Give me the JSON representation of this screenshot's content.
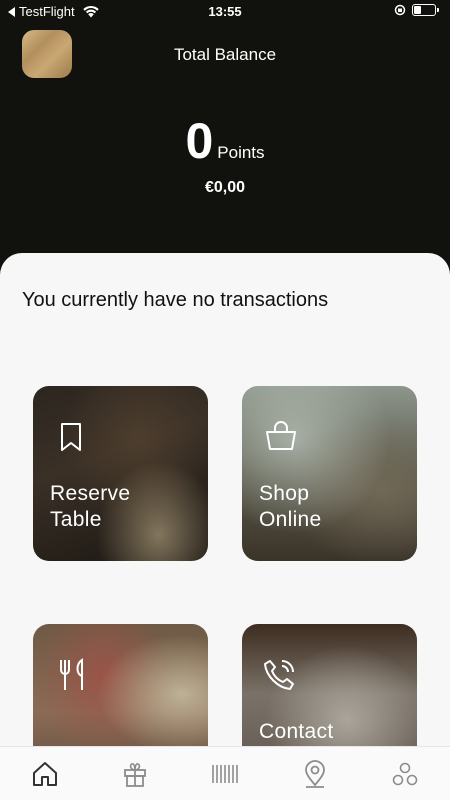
{
  "status_bar": {
    "back_app": "TestFlight",
    "time": "13:55",
    "battery_level": 0.35
  },
  "header": {
    "title": "Total Balance",
    "points_value": "0",
    "points_unit": "Points",
    "currency_value": "€0,00"
  },
  "transactions": {
    "empty_message": "You currently have no transactions"
  },
  "tiles": {
    "reserve": {
      "label_line1": "Reserve",
      "label_line2": "Table",
      "icon": "bookmark-icon"
    },
    "shop": {
      "label_line1": "Shop",
      "label_line2": "Online",
      "icon": "basket-icon"
    },
    "menu": {
      "icon": "cutlery-icon"
    },
    "contact": {
      "label_line1": "Contact",
      "icon": "phone-icon"
    }
  },
  "tabbar": {
    "items": [
      {
        "name": "home",
        "icon": "home-icon",
        "active": true
      },
      {
        "name": "gift",
        "icon": "gift-icon",
        "active": false
      },
      {
        "name": "barcode",
        "icon": "barcode-icon",
        "active": false
      },
      {
        "name": "location",
        "icon": "location-pin-icon",
        "active": false
      },
      {
        "name": "more",
        "icon": "circles-icon",
        "active": false
      }
    ]
  },
  "colors": {
    "header_bg": "#11110d",
    "sheet_bg": "#f7f7f7",
    "tabbar_bg": "#fafafa",
    "icon_gray": "#8c8c8c",
    "icon_active": "#333333"
  }
}
